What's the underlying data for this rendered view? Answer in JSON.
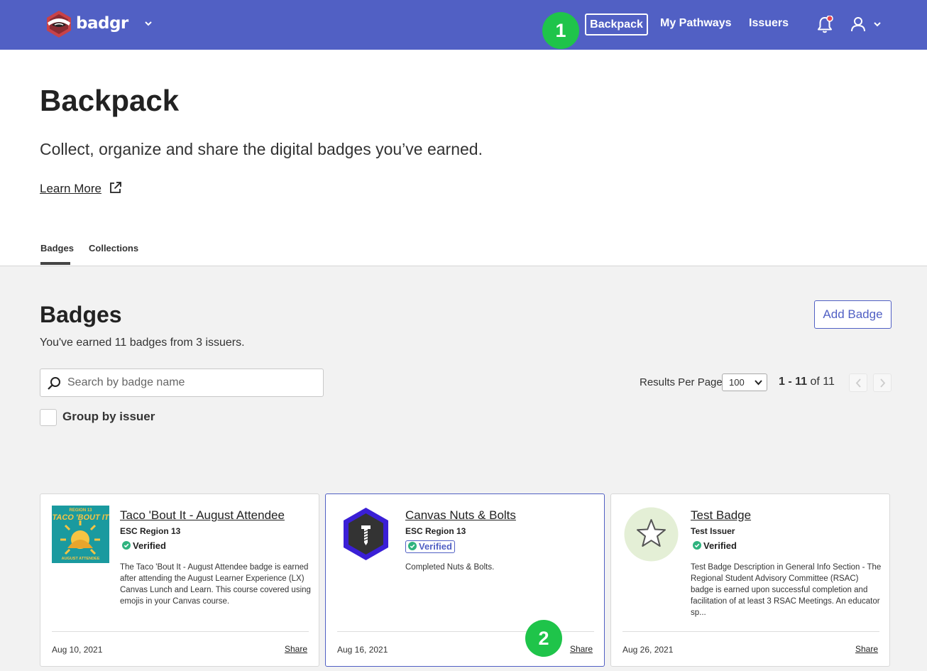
{
  "nav": {
    "logo_text": "badgr",
    "links": [
      "Backpack",
      "My Pathways",
      "Issuers"
    ]
  },
  "steps": [
    "1",
    "2"
  ],
  "header": {
    "title": "Backpack",
    "subtitle": "Collect, organize and share the digital badges you’ve earned.",
    "learn_more": "Learn More"
  },
  "tabs": [
    "Badges",
    "Collections"
  ],
  "section": {
    "title": "Badges",
    "summary": "You've earned 11 badges from 3 issuers.",
    "add_button": "Add Badge",
    "search_placeholder": "Search by badge name",
    "results_label": "Results Per Page",
    "results_value": "100",
    "range": "1 - 11",
    "range_of": "of 11",
    "group_label": "Group by issuer"
  },
  "cards": [
    {
      "title": "Taco 'Bout It - August Attendee",
      "issuer": "ESC Region 13",
      "verified": "Verified",
      "description": "The Taco 'Bout It - August Attendee badge is earned after attending the August Learner Experience (LX) Canvas Lunch and Learn. This course covered using emojis in your Canvas course.",
      "date": "Aug 10, 2021",
      "share": "Share",
      "image_top": "REGION 13",
      "image_main": "TACO 'BOUT IT",
      "image_bottom": "AUGUST ATTENDEE"
    },
    {
      "title": "Canvas Nuts & Bolts",
      "issuer": "ESC Region 13",
      "verified": "Verified",
      "description": "Completed Nuts & Bolts.",
      "date": "Aug 16, 2021",
      "share": "Share"
    },
    {
      "title": "Test Badge",
      "issuer": "Test Issuer",
      "verified": "Verified",
      "description": "Test Badge Description in General Info Section - The Regional Student Advisory Committee (RSAC) badge is earned upon successful completion and facilitation of at least 3 RSAC Meetings. An educator sp...",
      "date": "Aug 26, 2021",
      "share": "Share"
    }
  ],
  "colors": {
    "nav_bg": "#5160c4",
    "accent": "#5160c4",
    "step_bubble": "#1fc44a",
    "verified": "#2fb37f",
    "page_bg": "#f2f2f2"
  },
  "icons": [
    "badgr-logo-icon",
    "chevron-down-icon",
    "bell-icon",
    "user-icon",
    "external-link-icon",
    "search-icon",
    "verified-check-icon",
    "chevron-left-icon",
    "chevron-right-icon",
    "star-icon",
    "screw-icon"
  ]
}
